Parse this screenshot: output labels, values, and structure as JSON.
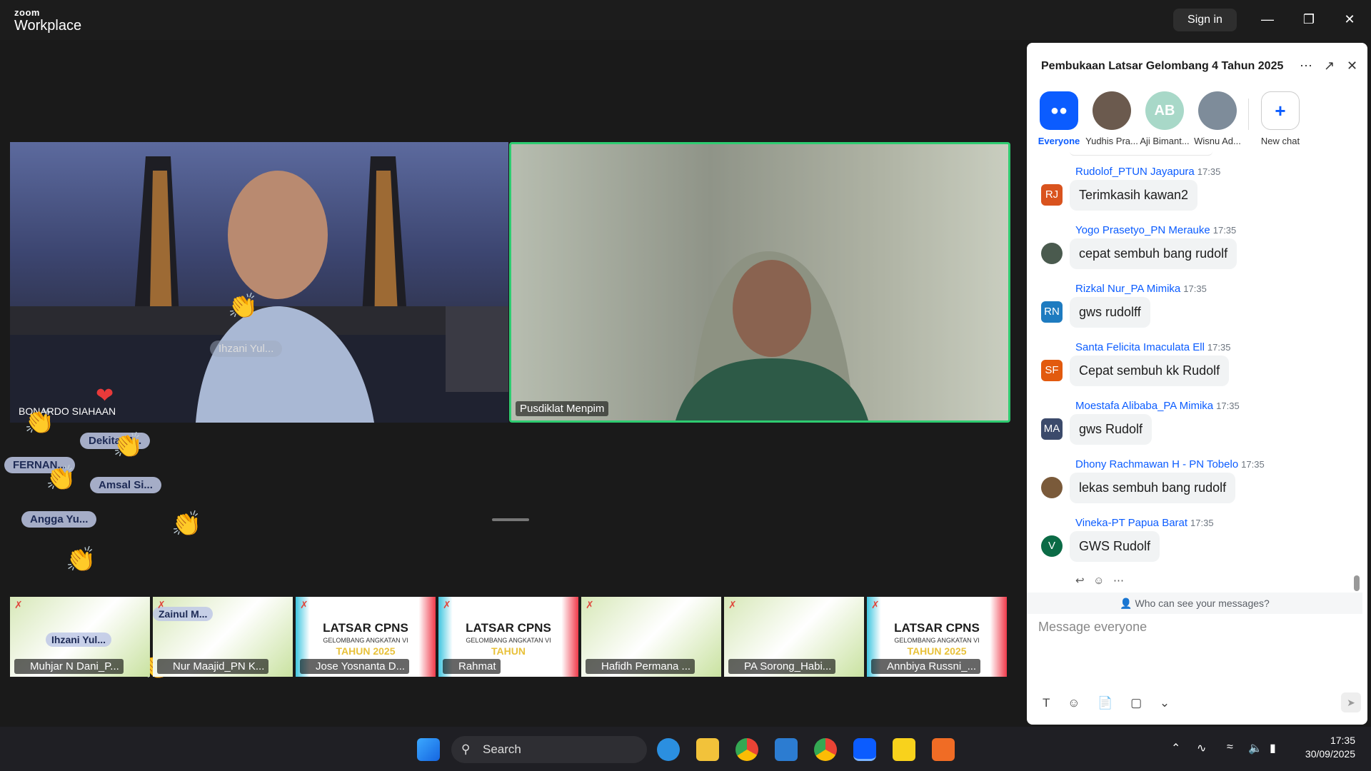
{
  "app": {
    "logo_top": "zoom",
    "logo_bottom": "Workplace",
    "sign_in": "Sign in"
  },
  "participants": {
    "main": [
      {
        "name": "BONARDO SIAHAAN"
      },
      {
        "name": "Pusdiklat Menpim"
      }
    ],
    "overlay_name": "Ihzani Yul...",
    "reaction_tags": [
      "Dekita M...",
      "FERNAN...",
      "Amsal Si...",
      "Angga Yu..."
    ],
    "strip": [
      {
        "name": "Muhjar N Dani_P...",
        "float_tag": "Ihzani Yul..."
      },
      {
        "name": "Nur Maajid_PN K...",
        "float_tag": "Zainul M..."
      },
      {
        "name": "Jose Yosnanta D...",
        "poster": "LATSAR CPNS",
        "poster_sub": "GELOMBANG ANGKATAN VI",
        "poster_year": "TAHUN 2025"
      },
      {
        "name": "Rahmat",
        "poster": "LATSAR CPNS",
        "poster_sub": "GELOMBANG ANGKATAN VI",
        "poster_year": "TAHUN"
      },
      {
        "name": "Hafidh Permana ..."
      },
      {
        "name": "PA Sorong_Habi..."
      },
      {
        "name": "Annbiya Russni_...",
        "poster": "LATSAR CPNS",
        "poster_sub": "GELOMBANG ANGKATAN VI",
        "poster_year": "TAHUN 2025"
      }
    ]
  },
  "chat": {
    "title": "Pembukaan Latsar Gelombang 4 Tahun 2025",
    "recipients": [
      {
        "label": "Everyone",
        "active": true
      },
      {
        "label": "Yudhis Pra..."
      },
      {
        "label": "Aji Bimant...",
        "initials": "AB"
      },
      {
        "label": "Wisnu Ad..."
      },
      {
        "label": "New chat"
      }
    ],
    "messages": [
      {
        "sender": "Rudolof_PTUN Jayapura",
        "time": "17:35",
        "text": "Terimkasih kawan2",
        "initials": "RJ",
        "color": "#d9531e"
      },
      {
        "sender": "Yogo Prasetyo_PN Merauke",
        "time": "17:35",
        "text": "cepat sembuh bang rudolf",
        "initials": "",
        "color": "#4a5a4e"
      },
      {
        "sender": "Rizkal Nur_PA Mimika",
        "time": "17:35",
        "text": "gws rudolff",
        "initials": "RN",
        "color": "#1e7bc0"
      },
      {
        "sender": "Santa Felicita Imaculata Ell",
        "time": "17:35",
        "text": "Cepat sembuh kk Rudolf",
        "initials": "SF",
        "color": "#e25a0e"
      },
      {
        "sender": "Moestafa Alibaba_PA Mimika",
        "time": "17:35",
        "text": "gws Rudolf",
        "initials": "MA",
        "color": "#3b4a6b"
      },
      {
        "sender": "Dhony Rachmawan H - PN Tobelo",
        "time": "17:35",
        "text": "lekas sembuh bang rudolf",
        "initials": "",
        "color": "#7a5a3a"
      },
      {
        "sender": "Vineka-PT Papua Barat",
        "time": "17:35",
        "text": "GWS Rudolf",
        "initials": "V",
        "color": "#0b6b46"
      }
    ],
    "privacy": "Who can see your messages?",
    "placeholder": "Message everyone"
  },
  "taskbar": {
    "search": "Search",
    "time": "17:35",
    "date": "30/09/2025"
  },
  "colors": {
    "accent": "#0b5cff",
    "active_speaker_border": "#2ecc71"
  }
}
